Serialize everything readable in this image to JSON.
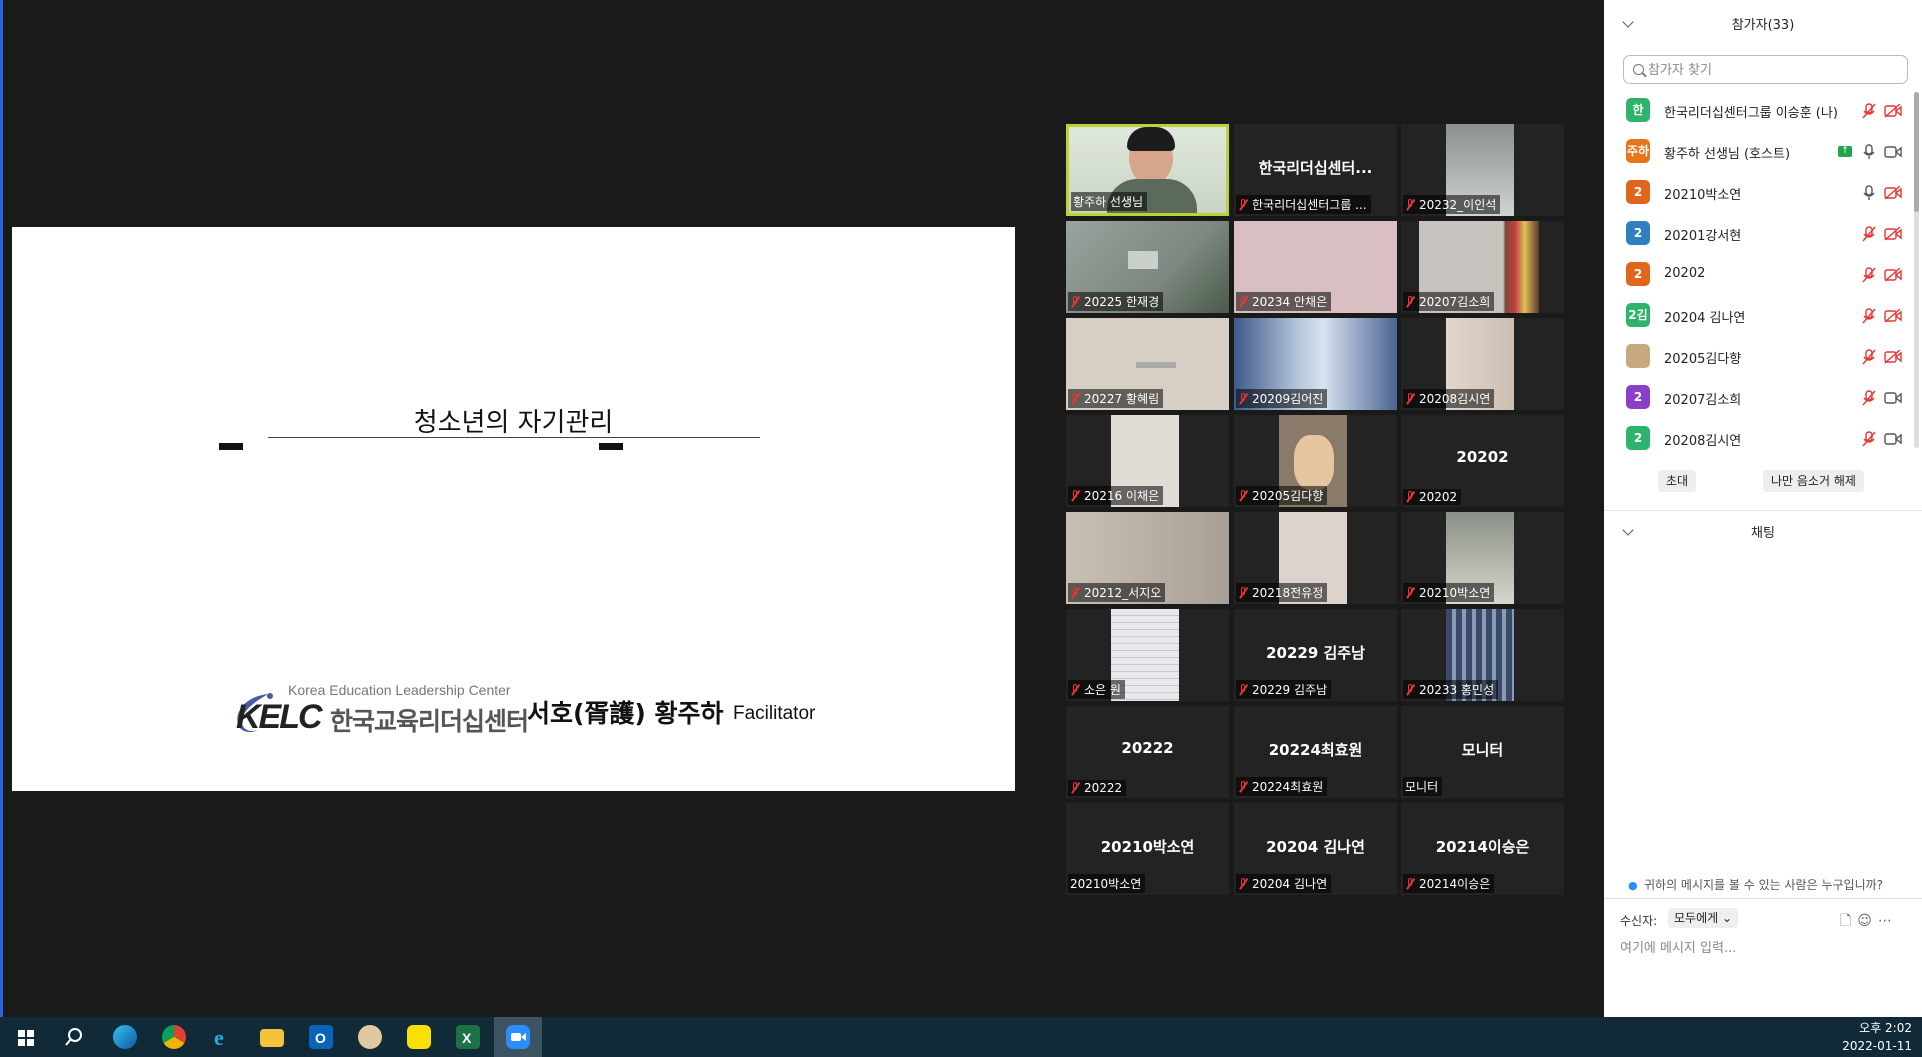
{
  "slide": {
    "title": "청소년의 자기관리",
    "kelc_subtitle": "Korea Education Leadership Center",
    "kelc_logo": "KELC",
    "kelc_korean": "한국교육리더십센터",
    "presenter": "서호(胥護) 황주하",
    "role": "Facilitator"
  },
  "gallery": [
    {
      "label": "황주하 선생님",
      "muted": false,
      "big": "",
      "video": "person",
      "active": true
    },
    {
      "label": "한국리더십센터그룹 ...",
      "muted": true,
      "big": "한국리더십센터...",
      "video": ""
    },
    {
      "label": "20232_이인석",
      "muted": true,
      "big": "",
      "video": "ceiling"
    },
    {
      "label": "20225 한재경",
      "muted": true,
      "big": "",
      "video": "ceiling2"
    },
    {
      "label": "20234 안채은",
      "muted": true,
      "big": "",
      "video": "pink"
    },
    {
      "label": "20207김소희",
      "muted": true,
      "big": "",
      "video": "shelf"
    },
    {
      "label": "20227 황혜림",
      "muted": true,
      "big": "",
      "video": "wall"
    },
    {
      "label": "20209김어진",
      "muted": true,
      "big": "",
      "video": "window"
    },
    {
      "label": "20208김시연",
      "muted": true,
      "big": "",
      "video": "corner"
    },
    {
      "label": "20216 이채은",
      "muted": true,
      "big": "",
      "video": "wall2"
    },
    {
      "label": "20205김다향",
      "muted": true,
      "big": "",
      "video": "cat"
    },
    {
      "label": "20202",
      "muted": true,
      "big": "20202",
      "video": ""
    },
    {
      "label": "20212_서지오",
      "muted": true,
      "big": "",
      "video": "wall3"
    },
    {
      "label": "20218전유정",
      "muted": true,
      "big": "",
      "video": "wall4"
    },
    {
      "label": "20210박소연",
      "muted": true,
      "big": "",
      "video": "room"
    },
    {
      "label": "소은 원",
      "muted": true,
      "big": "",
      "video": "paper"
    },
    {
      "label": "20229 김주남",
      "muted": true,
      "big": "20229 김주남",
      "video": ""
    },
    {
      "label": "20233 홍민성",
      "muted": true,
      "big": "",
      "video": "curtain"
    },
    {
      "label": "20222",
      "muted": true,
      "big": "20222",
      "video": ""
    },
    {
      "label": "20224최효원",
      "muted": true,
      "big": "20224최효원",
      "video": ""
    },
    {
      "label": "모니터",
      "muted": false,
      "big": "모니터",
      "video": ""
    },
    {
      "label": "20210박소연",
      "muted": false,
      "big": "20210박소연",
      "video": ""
    },
    {
      "label": "20204 김나연",
      "muted": true,
      "big": "20204 김나연",
      "video": ""
    },
    {
      "label": "20214이승은",
      "muted": true,
      "big": "20214이승은",
      "video": ""
    }
  ],
  "panel": {
    "participants_title": "참가자(33)",
    "search_placeholder": "참가자 찾기",
    "participants": [
      {
        "avatar": "한",
        "color": "#2db36b",
        "name": "한국리더십센터그룹 이승훈 (나)",
        "mic": "muted",
        "cam": "off",
        "share": false
      },
      {
        "avatar": "주하",
        "color": "#e8751a",
        "name": "황주하 선생님 (호스트)",
        "mic": "on",
        "cam": "on",
        "share": true
      },
      {
        "avatar": "2",
        "color": "#e0661e",
        "name": "20210박소연",
        "mic": "on",
        "cam": "off",
        "share": false
      },
      {
        "avatar": "2",
        "color": "#2f7fc1",
        "name": "20201강서현",
        "mic": "muted",
        "cam": "off",
        "share": false
      },
      {
        "avatar": "2",
        "color": "#e0661e",
        "name": "20202",
        "mic": "muted",
        "cam": "off",
        "share": false
      },
      {
        "avatar": "2김",
        "color": "#2db36b",
        "name": "20204 김나연",
        "mic": "muted",
        "cam": "off",
        "share": false
      },
      {
        "avatar": "",
        "color": "#c8a880",
        "name": "20205김다향",
        "mic": "muted",
        "cam": "off",
        "share": false
      },
      {
        "avatar": "2",
        "color": "#8a3fc8",
        "name": "20207김소희",
        "mic": "muted",
        "cam": "on",
        "share": false
      },
      {
        "avatar": "2",
        "color": "#2db36b",
        "name": "20208김시연",
        "mic": "muted",
        "cam": "on",
        "share": false
      }
    ],
    "share_badge": "↑",
    "invite_label": "초대",
    "unmute_label": "나만 음소거 해제",
    "chat_title": "채팅",
    "who_can_see": "귀하의 메시지를 볼 수 있는 사람은 누구입니까?",
    "recipient_label": "수신자:",
    "recipient_value": "모두에게",
    "chat_tools": "🗋☺⋯",
    "chat_placeholder": "여기에 메시지 입력..."
  },
  "taskbar": {
    "time": "오후 2:02",
    "date": "2022-01-11",
    "apps": [
      "start-icon",
      "search-icon",
      "edge-icon",
      "chrome-icon",
      "ie-icon",
      "file-explorer-icon",
      "outlook-icon",
      "paint-icon",
      "kakaotalk-icon",
      "excel-icon",
      "zoom-icon"
    ]
  }
}
